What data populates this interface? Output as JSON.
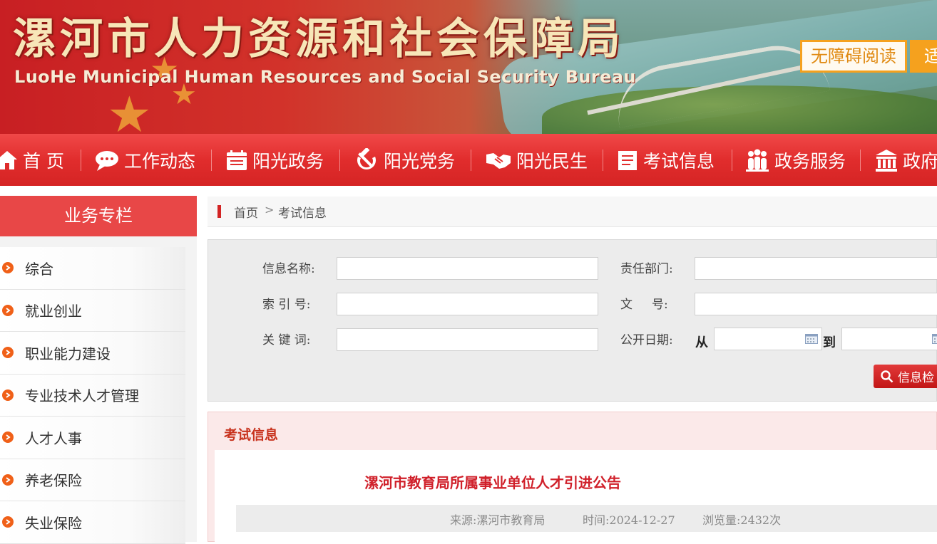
{
  "header": {
    "title": "漯河市人力资源和社会保障局",
    "subtitle": "LuoHe Municipal Human Resources and Social Security Bureau",
    "accessibility_label": "无障碍阅读",
    "mode_label": "适"
  },
  "nav": {
    "items": [
      {
        "label": "首 页",
        "icon": "home-icon"
      },
      {
        "label": "工作动态",
        "icon": "chat-bubble-icon"
      },
      {
        "label": "阳光政务",
        "icon": "calendar-icon"
      },
      {
        "label": "阳光党务",
        "icon": "hammer-sickle-icon"
      },
      {
        "label": "阳光民生",
        "icon": "handshake-icon"
      },
      {
        "label": "考试信息",
        "icon": "document-icon"
      },
      {
        "label": "政务服务",
        "icon": "people-icon"
      },
      {
        "label": "政府",
        "icon": "government-building-icon"
      }
    ]
  },
  "sidebar": {
    "title": "业务专栏",
    "items": [
      {
        "label": "综合"
      },
      {
        "label": "就业创业"
      },
      {
        "label": "职业能力建设"
      },
      {
        "label": "专业技术人才管理"
      },
      {
        "label": "人才人事"
      },
      {
        "label": "养老保险"
      },
      {
        "label": "失业保险"
      }
    ]
  },
  "breadcrumb": {
    "home": "首页",
    "separator": ">",
    "current": "考试信息"
  },
  "search": {
    "info_name_label": "信息名称:",
    "dept_label": "责任部门:",
    "index_label": "索 引 号:",
    "doc_no_label": "文     号:",
    "keyword_label": "关 键 词:",
    "date_label": "公开日期:",
    "from_label": "从",
    "to_label": "到",
    "info_name_value": "",
    "dept_value": "",
    "index_value": "",
    "doc_no_value": "",
    "keyword_value": "",
    "date_from_value": "",
    "date_to_value": "",
    "button_label": "信息检"
  },
  "article": {
    "section_title": "考试信息",
    "title": "漯河市教育局所属事业单位人才引进公告",
    "source": "来源:漯河市教育局",
    "time": "时间:2024-12-27",
    "views": "浏览量:2432次"
  },
  "colors": {
    "brand_red": "#e12d2d",
    "sidebar_head": "#e84747",
    "bullet_orange": "#f06018",
    "accessibility_orange": "#f5a11e",
    "article_title_red": "#d0202a"
  }
}
